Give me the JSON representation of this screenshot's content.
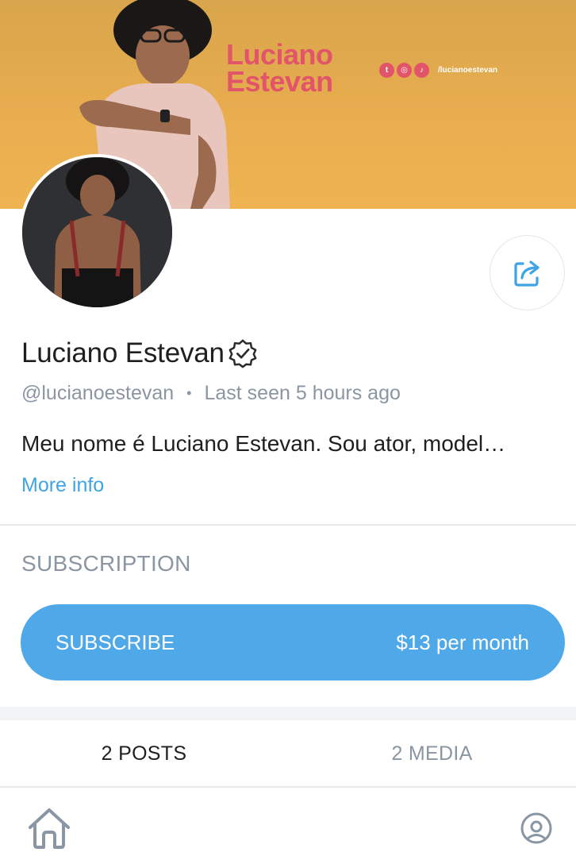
{
  "banner": {
    "name_line1": "Luciano",
    "name_line2": "Estevan",
    "social_handle": "/lucianoestevan",
    "accent_color": "#e2546a",
    "icons": [
      "twitter-icon",
      "instagram-icon",
      "tiktok-icon"
    ]
  },
  "profile": {
    "name": "Luciano Estevan",
    "username": "@lucianoestevan",
    "last_seen": "Last seen 5 hours ago",
    "bio": "Meu nome é Luciano Estevan. Sou ator, model…",
    "more_info": "More info"
  },
  "subscription": {
    "heading": "SUBSCRIPTION",
    "button_label": "SUBSCRIBE",
    "price": "$13 per month",
    "button_color": "#4fa9e8"
  },
  "tabs": [
    {
      "label": "2 POSTS",
      "active": true
    },
    {
      "label": "2 MEDIA",
      "active": false
    }
  ],
  "nav": {
    "items": [
      "home-icon",
      "profile-icon"
    ]
  }
}
